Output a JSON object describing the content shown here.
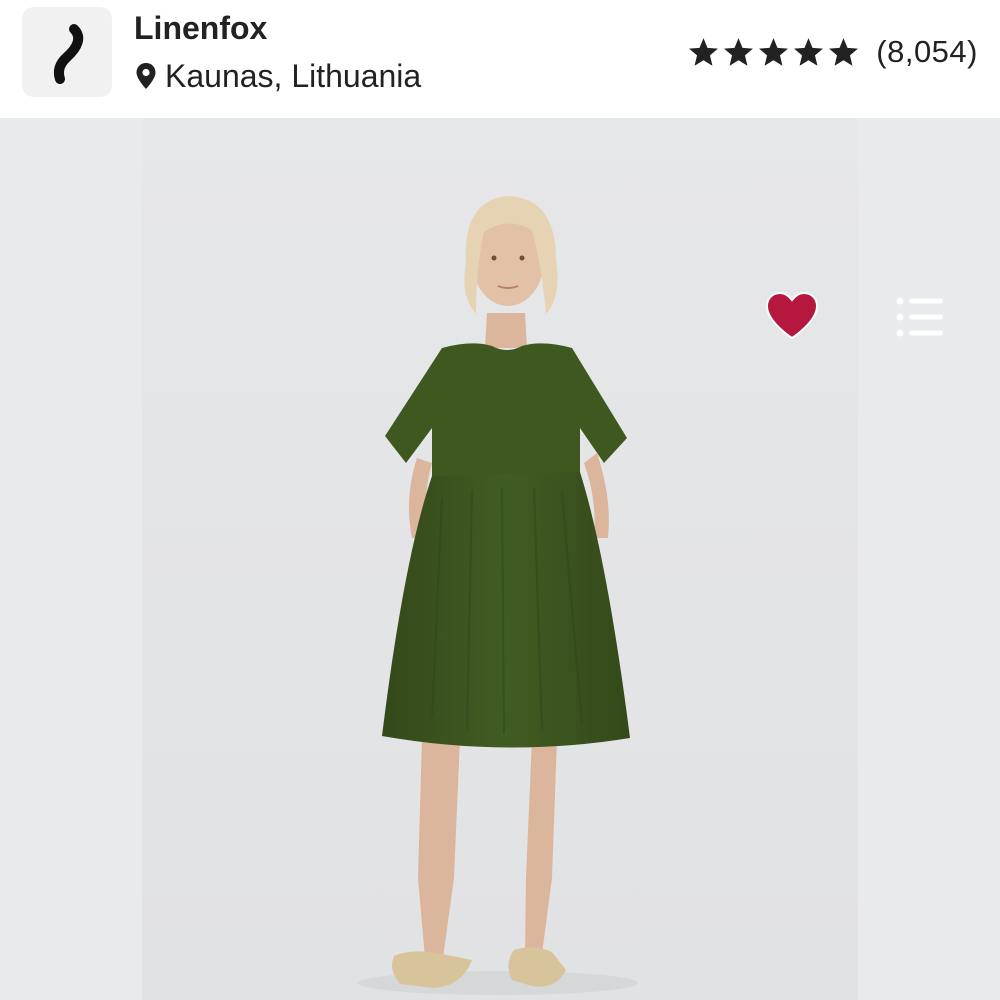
{
  "shop": {
    "name": "Linenfox",
    "location": "Kaunas, Lithuania",
    "rating_stars": 5,
    "review_count": "(8,054)"
  },
  "listing": {
    "favorited": true
  },
  "colors": {
    "favorite_heart": "#b5173f",
    "text_primary": "#222222",
    "dress": "#3f5a1f",
    "background": "#e9eaec"
  },
  "icons": {
    "pin": "location-pin-icon",
    "star": "star-icon",
    "heart": "heart-icon",
    "menu": "list-menu-icon"
  }
}
